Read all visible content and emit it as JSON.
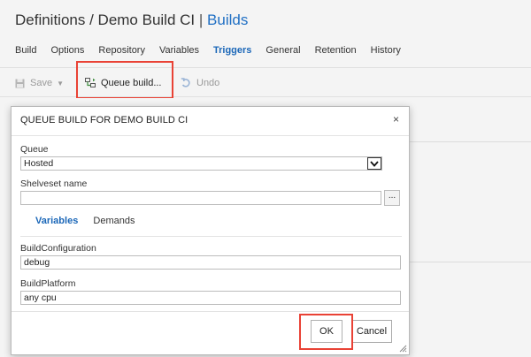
{
  "header": {
    "breadcrumb_prefix": "Definitions / Demo Build CI",
    "breadcrumb_sep": "|",
    "breadcrumb_link": "Builds"
  },
  "tabs": [
    {
      "label": "Build",
      "active": false
    },
    {
      "label": "Options",
      "active": false
    },
    {
      "label": "Repository",
      "active": false
    },
    {
      "label": "Variables",
      "active": false
    },
    {
      "label": "Triggers",
      "active": true
    },
    {
      "label": "General",
      "active": false
    },
    {
      "label": "Retention",
      "active": false
    },
    {
      "label": "History",
      "active": false
    }
  ],
  "toolbar": {
    "save_label": "Save",
    "queue_label": "Queue build...",
    "undo_label": "Undo"
  },
  "dialog": {
    "title": "QUEUE BUILD FOR DEMO BUILD CI",
    "close_glyph": "×",
    "queue_label": "Queue",
    "queue_value": "Hosted",
    "shelveset_label": "Shelveset name",
    "shelveset_value": "",
    "ellipsis_label": "...",
    "subtabs": [
      {
        "label": "Variables",
        "active": true
      },
      {
        "label": "Demands",
        "active": false
      }
    ],
    "build_config_label": "BuildConfiguration",
    "build_config_value": "debug",
    "build_platform_label": "BuildPlatform",
    "build_platform_value": "any cpu",
    "ok_label": "OK",
    "cancel_label": "Cancel"
  },
  "colors": {
    "accent": "#1b67b8",
    "highlight": "#e94235",
    "background": "#f4f4f4"
  }
}
